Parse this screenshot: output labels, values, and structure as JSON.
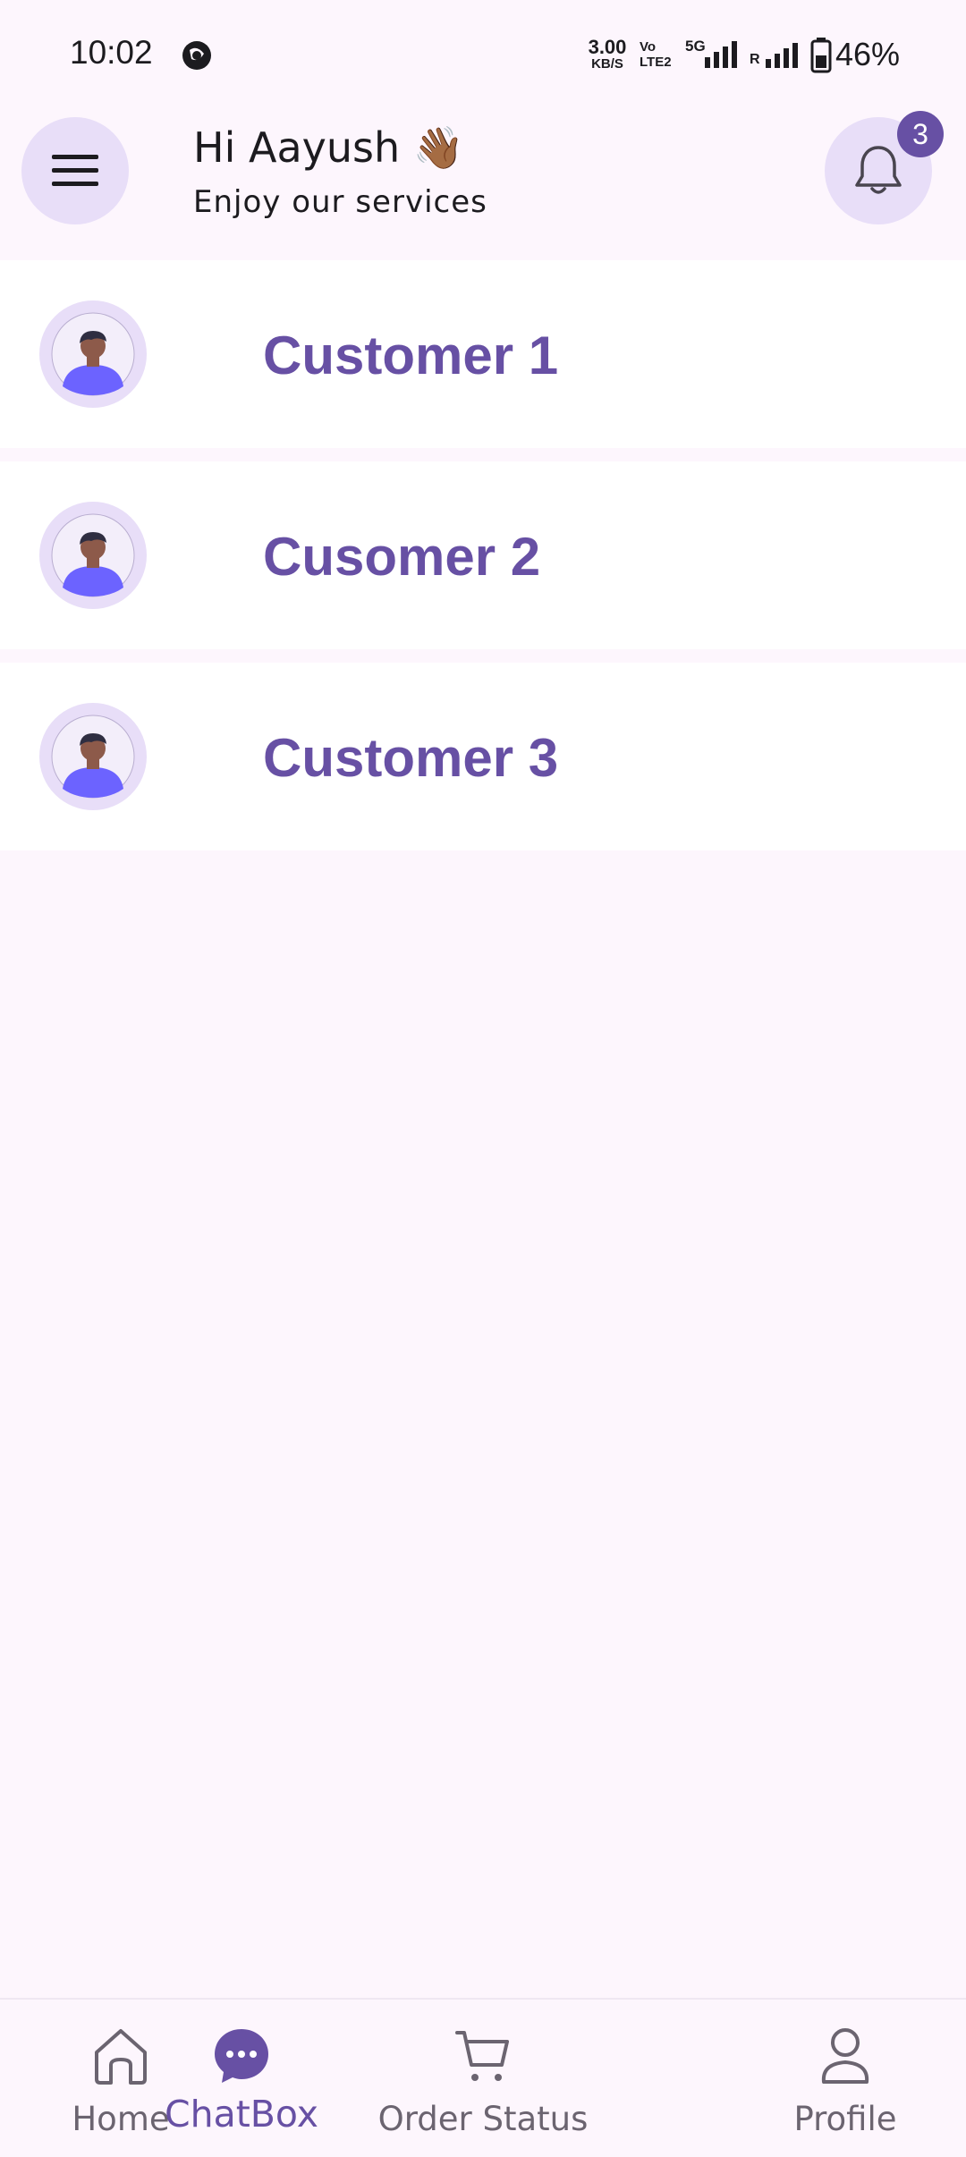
{
  "status_bar": {
    "time": "10:02",
    "net_speed_value": "3.00",
    "net_speed_unit": "KB/S",
    "volte_top": "Vo",
    "volte_bottom": "LTE2",
    "network": "5G",
    "roaming": "R",
    "battery": "46%"
  },
  "header": {
    "greeting": "Hi Aayush 👋🏾",
    "subtitle": "Enjoy our services",
    "notification_count": "3"
  },
  "customers": [
    {
      "name": "Customer 1"
    },
    {
      "name": "Cusomer 2"
    },
    {
      "name": "Customer 3"
    }
  ],
  "bottom_nav": {
    "items": [
      {
        "label": "Home",
        "icon": "home-icon",
        "active": false
      },
      {
        "label": "ChatBox",
        "icon": "chat-icon",
        "active": true
      },
      {
        "label": "Order Status",
        "icon": "cart-icon",
        "active": false
      },
      {
        "label": "Profile",
        "icon": "person-icon",
        "active": false
      }
    ]
  },
  "colors": {
    "accent": "#6750a4",
    "surface": "#fdf6fd",
    "chip": "#e8def8",
    "row": "#ffffff"
  }
}
